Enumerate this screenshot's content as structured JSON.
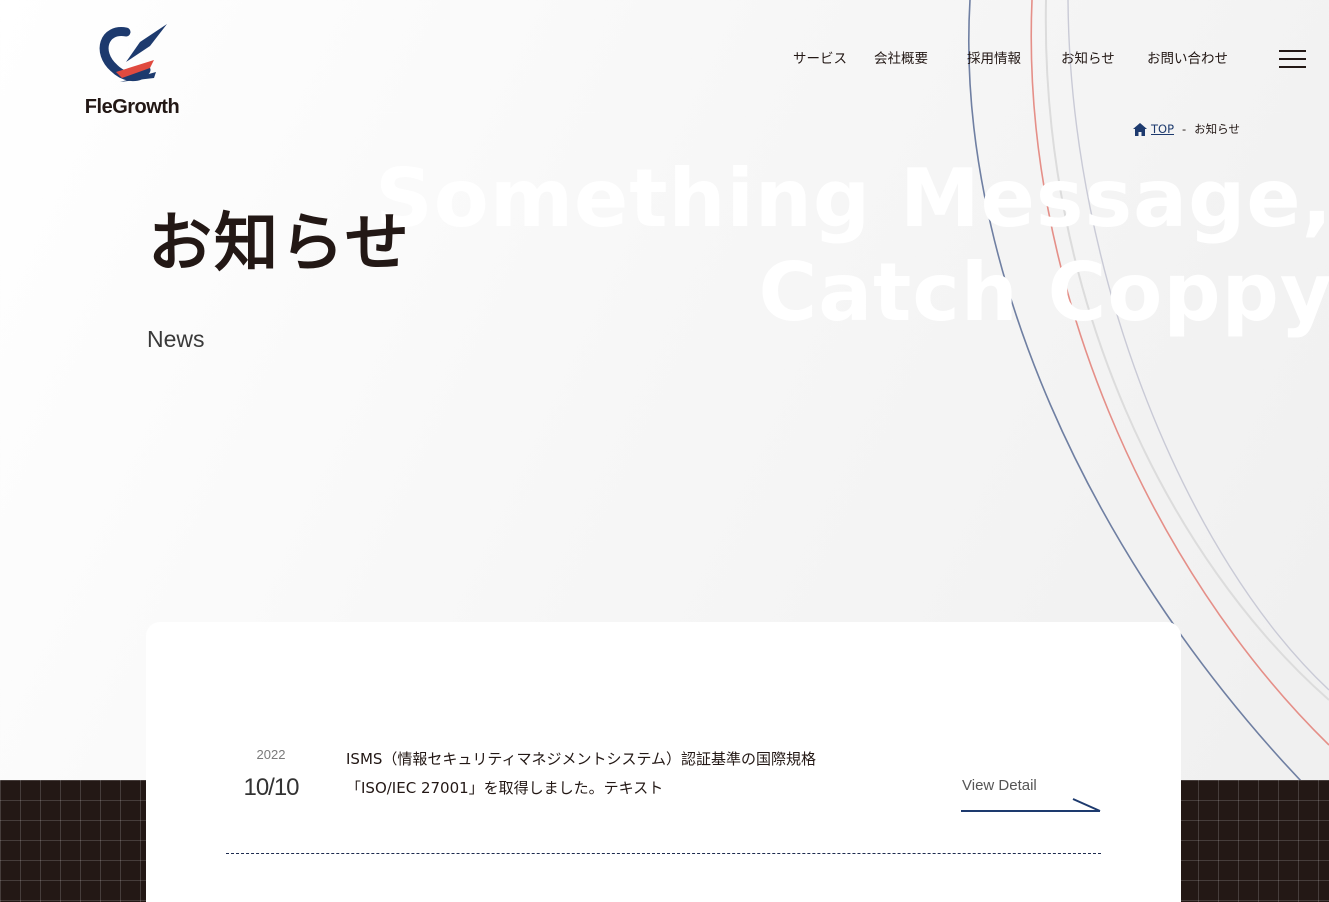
{
  "brand": {
    "name": "FleGrowth",
    "colors": {
      "navy": "#1d3a6e",
      "red": "#e04a3f",
      "dark": "#231815"
    }
  },
  "nav": {
    "items": [
      "サービス",
      "会社概要",
      "採用情報",
      "お知らせ",
      "お問い合わせ"
    ],
    "menu_icon": "hamburger-icon"
  },
  "breadcrumb": {
    "home_icon": "home-icon",
    "home": "TOP",
    "separator": "-",
    "current": "お知らせ"
  },
  "hero": {
    "title": "お知らせ",
    "subtitle": "News",
    "bg_text_line1": "Something Message,",
    "bg_text_line2": "Catch Coppy"
  },
  "news": {
    "items": [
      {
        "year": "2022",
        "date": "10/10",
        "title_line1": "ISMS（情報セキュリティマネジメントシステム）認証基準の国際規格",
        "title_line2": "「ISO/IEC 27001」を取得しました。テキスト",
        "link_label": "View Detail",
        "link_icon": "arrow-right-icon"
      }
    ]
  }
}
